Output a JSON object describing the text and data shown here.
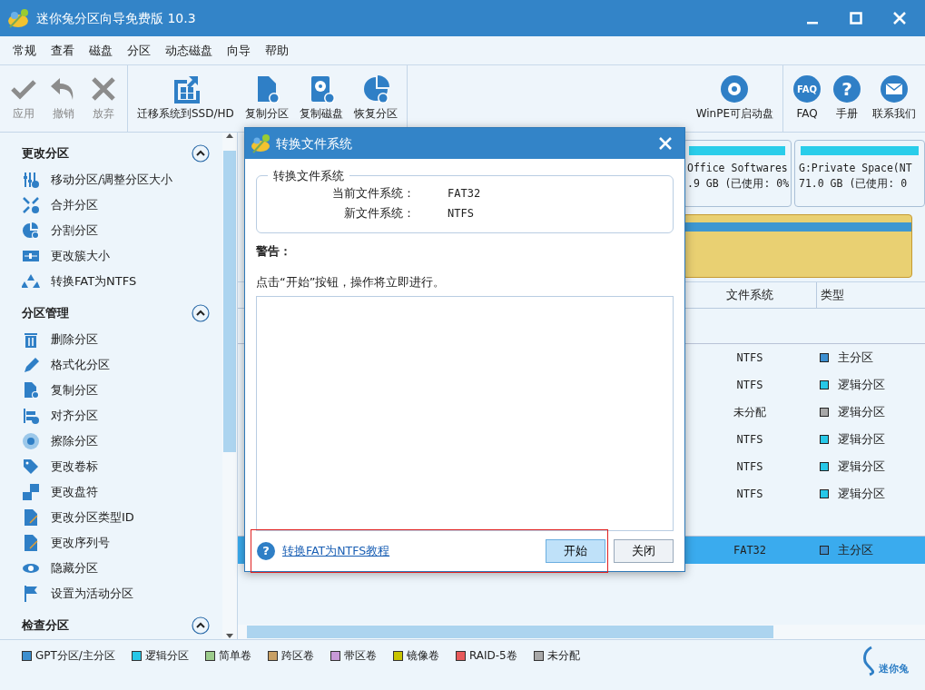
{
  "window": {
    "title": "迷你兔分区向导免费版 10.3"
  },
  "menu": [
    "常规",
    "查看",
    "磁盘",
    "分区",
    "动态磁盘",
    "向导",
    "帮助"
  ],
  "toolbar": {
    "groups": [
      [
        {
          "label": "应用",
          "disabled": true
        },
        {
          "label": "撤销",
          "disabled": true
        },
        {
          "label": "放弃",
          "disabled": true
        }
      ],
      [
        {
          "label": "迁移系统到SSD/HD",
          "disabled": false
        },
        {
          "label": "复制分区",
          "disabled": false
        },
        {
          "label": "复制磁盘",
          "disabled": false
        },
        {
          "label": "恢复分区",
          "disabled": false
        }
      ],
      [
        {
          "label": "WinPE可启动盘",
          "disabled": false
        }
      ],
      [
        {
          "label": "FAQ",
          "disabled": false,
          "icon_text": "FAQ"
        },
        {
          "label": "手册",
          "disabled": false,
          "icon_text": "?"
        },
        {
          "label": "联系我们",
          "disabled": false
        }
      ]
    ]
  },
  "sidebar": {
    "sections": [
      {
        "title": "更改分区",
        "expanded": true,
        "items": [
          "移动分区/调整分区大小",
          "合并分区",
          "分割分区",
          "更改簇大小",
          "转换FAT为NTFS"
        ]
      },
      {
        "title": "分区管理",
        "expanded": true,
        "items": [
          "删除分区",
          "格式化分区",
          "复制分区",
          "对齐分区",
          "擦除分区",
          "更改卷标",
          "更改盘符",
          "更改分区类型ID",
          "更改序列号",
          "隐藏分区",
          "设置为活动分区"
        ]
      },
      {
        "title": "检查分区",
        "expanded": true
      }
    ]
  },
  "disk_map": {
    "partitions": [
      {
        "name": "Office Softwares",
        "detail": ".9 GB (已使用: 0%",
        "color": "#29cdea"
      },
      {
        "name": "G:Private Space(NT",
        "detail": "71.0 GB (已使用: 0",
        "color": "#29cdea"
      }
    ]
  },
  "table": {
    "columns": [
      "文件系统",
      "类型"
    ],
    "disks": [
      {
        "rows": [
          {
            "file_system": "NTFS",
            "type": "主分区",
            "color": "#3c8fd0",
            "selected": false
          },
          {
            "file_system": "NTFS",
            "type": "逻辑分区",
            "color": "#27c8e8",
            "selected": false
          },
          {
            "file_system": "未分配",
            "type": "逻辑分区",
            "color": "#a8a8a8",
            "selected": false
          },
          {
            "file_system": "NTFS",
            "type": "逻辑分区",
            "color": "#27c8e8",
            "selected": false
          },
          {
            "file_system": "NTFS",
            "type": "逻辑分区",
            "color": "#27c8e8",
            "selected": false
          },
          {
            "file_system": "NTFS",
            "type": "逻辑分区",
            "color": "#27c8e8",
            "selected": false
          }
        ]
      },
      {
        "rows": [
          {
            "file_system": "FAT32",
            "type": "主分区",
            "color": "#3c8fd0",
            "selected": true
          }
        ]
      }
    ]
  },
  "dialog": {
    "title": "转换文件系统",
    "group_title": "转换文件系统",
    "fields": [
      {
        "label": "当前文件系统：",
        "value": "FAT32"
      },
      {
        "label": "新文件系统：",
        "value": "NTFS"
      }
    ],
    "warning_label": "警告：",
    "message": "点击“开始”按钮，操作将立即进行。",
    "help_icon_text": "?",
    "help_link": "转换FAT为NTFS教程",
    "buttons": [
      {
        "label": "开始",
        "selected": true
      },
      {
        "label": "关闭",
        "selected": false
      }
    ]
  },
  "legend": [
    {
      "label": "GPT分区/主分区",
      "color": "#3c8fd0"
    },
    {
      "label": "逻辑分区",
      "color": "#27c8e8"
    },
    {
      "label": "简单卷",
      "color": "#9ccc8c"
    },
    {
      "label": "跨区卷",
      "color": "#c8a064"
    },
    {
      "label": "带区卷",
      "color": "#c89ad8"
    },
    {
      "label": "镜像卷",
      "color": "#c8c400"
    },
    {
      "label": "RAID-5卷",
      "color": "#e85a5a"
    },
    {
      "label": "未分配",
      "color": "#a8a8a8"
    }
  ],
  "logo": {
    "text": "迷你兔"
  }
}
